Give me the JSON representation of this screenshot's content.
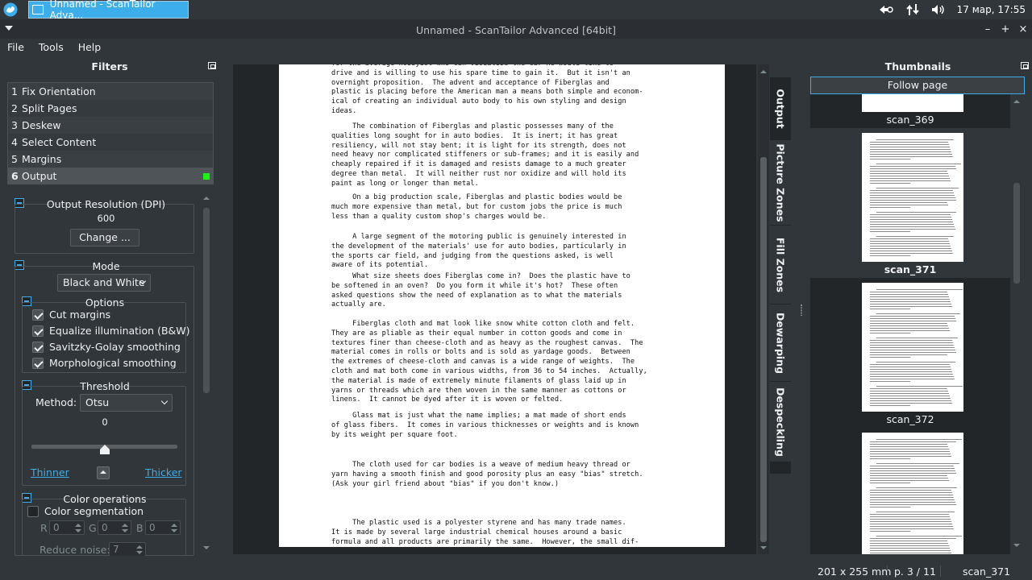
{
  "taskbar": {
    "app_task_label": "Unnamed - ScanTailor Adva...",
    "clock": "17 мар, 17:55"
  },
  "window": {
    "title": "Unnamed - ScanTailor Advanced [64bit]"
  },
  "menu": [
    "File",
    "Tools",
    "Help"
  ],
  "filters_panel": {
    "title": "Filters",
    "stages": [
      {
        "num": "1",
        "label": "Fix Orientation"
      },
      {
        "num": "2",
        "label": "Split Pages"
      },
      {
        "num": "3",
        "label": "Deskew"
      },
      {
        "num": "4",
        "label": "Select Content"
      },
      {
        "num": "5",
        "label": "Margins"
      },
      {
        "num": "6",
        "label": "Output"
      }
    ],
    "output_resolution": {
      "title": "Output Resolution (DPI)",
      "value": "600",
      "change_label": "Change ..."
    },
    "mode": {
      "title": "Mode",
      "selected": "Black and White"
    },
    "options": {
      "title": "Options",
      "items": [
        {
          "label": "Cut margins",
          "checked": true
        },
        {
          "label": "Equalize illumination (B&W)",
          "checked": true
        },
        {
          "label": "Savitzky-Golay smoothing",
          "checked": true
        },
        {
          "label": "Morphological smoothing",
          "checked": true
        }
      ]
    },
    "threshold": {
      "title": "Threshold",
      "method_label": "Method:",
      "method_value": "Otsu",
      "value": "0",
      "slider_fraction": 0.5,
      "thinner": "Thinner",
      "thicker": "Thicker"
    },
    "color_operations": {
      "title": "Color operations",
      "segmentation_label": "Color segmentation",
      "segmentation_checked": false,
      "r_label": "R",
      "r_value": "0",
      "g_label": "G",
      "g_value": "0",
      "b_label": "B",
      "b_value": "0",
      "reduce_noise_label": "Reduce noise:",
      "reduce_noise_value": "7"
    }
  },
  "viewer": {
    "paragraphs": [
      "for the average hobbyist who can visualize the car he would like to\ndrive and is willing to use his spare time to gain it.  But it isn't an\novernight proposition.  The advent and acceptance of Fiberglas and\nplastic is placing before the American man a means both simple and econom-\nical of creating an individual auto body to his own styling and design\nideas.",
      "     The combination of Fiberglas and plastic possesses many of the\nqualities long sought for in auto bodies.  It is inert; it has great\nresiliency, will not stay bent; it is light for its strength, does not\nneed heavy nor complicated stiffeners or sub-frames; and it is easily and\ncheaply repaired if it is damaged and resists damage to a much greater\ndegree than metal.  It will neither rust nor oxidize and will hold its\npaint as long or longer than metal.",
      "     On a big production scale, Fiberglas and plastic bodies would be\nmuch more expensive than metal, but for custom jobs the price is much\nless than a quality custom shop's charges would be.",
      "     A large segment of the motoring public is genuinely interested in\nthe development of the materials' use for auto bodies, particularly in\nthe sports car field, and judging from the questions asked, is well\naware of its potential.",
      "     What size sheets does Fiberglas come in?  Does the plastic have to\nbe softened in an oven?  Do you form it while it's hot?  These often\nasked questions show the need of explanation as to what the materials\nactually are.",
      "     Fiberglas cloth and mat look like snow white cotton cloth and felt.\nThey are as pliable as their equal number in cotton goods and come in\ntextures finer than cheese-cloth and as heavy as the roughest canvas.  The\nmaterial comes in rolls or bolts and is sold as yardage goods.  Between\nthe extremes of cheese-cloth and canvas is a wide range of weights.  The\ncloth and mat both come in various widths, from 36 to 54 inches.  Actually,\nthe material is made of extremely minute filaments of glass laid up in\nyarns or threads which are then woven in the same manner as cottons or\nlinens.  It cannot be dyed after it is woven or felted.",
      "     Glass mat is just what the name implies; a mat made of short ends\nof glass fibers.  It comes in various thicknesses or weights and is known\nby its weight per square foot.",
      "     The cloth used for car bodies is a weave of medium heavy thread or\nyarn having a smooth finish and good porosity plus an easy \"bias\" stretch.\n(Ask your girl friend about \"bias\" if you don't know.)",
      "     The plastic used is a polyester styrene and has many trade names.\nIt is made by several large industrial chemical houses around a basic\nformula and all products are primarily the same.  However, the small dif-\nferences in their chemical structure does have the effect of slightly"
    ]
  },
  "side_tabs": [
    "Output",
    "Picture Zones",
    "Fill Zones",
    "Dewarping",
    "Despeckling"
  ],
  "thumbnails_panel": {
    "title": "Thumbnails",
    "follow_page": "Follow page",
    "items": [
      {
        "label": "scan_369",
        "selected": false
      },
      {
        "label": "scan_371",
        "selected": true
      },
      {
        "label": "scan_372",
        "selected": false
      }
    ]
  },
  "statusbar": {
    "size": "201 x 255 mm",
    "page": "p. 3 / 11",
    "file": "scan_371"
  }
}
